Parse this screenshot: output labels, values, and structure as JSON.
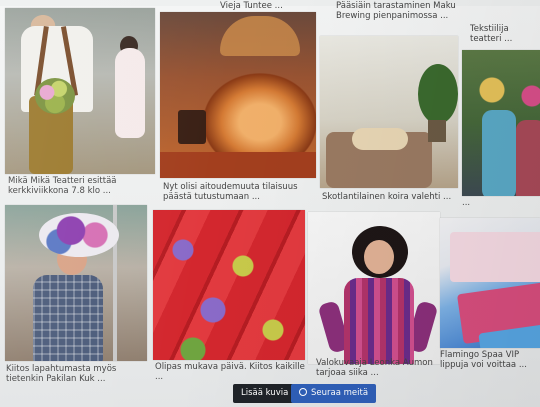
{
  "gallery": {
    "top_captions": [
      "Vieja Tuntee ...",
      "Pääsiäin tarastaminen Maku Brewing pienpanimossa ...",
      "Tekstiilija teatteri ..."
    ],
    "items": [
      {
        "caption": "Mikä Mikä Teatteri esittää kerkkiviikkona 7.8 klo ...",
        "image": "man-with-flowers-photo"
      },
      {
        "caption": "Nyt olisi aitoudemuuta tilaisuus päästä tutustumaan ...",
        "image": "copper-kettle-photo"
      },
      {
        "caption": "Skotlantilainen koira valehti ...",
        "image": "dog-on-couch-photo"
      },
      {
        "caption": "...",
        "image": "flower-festival-photo"
      },
      {
        "caption": "Kiitos lapahtumasta myös tietenkin Pakilan Kuk ...",
        "image": "woman-flower-hat-photo"
      },
      {
        "caption": "Olipas mukava päivä. Kiitos kaikille ...",
        "image": "red-flower-boxes-photo"
      },
      {
        "caption": "Valokuvaaja Leonka Aumon tarjoaa siika ...",
        "image": "woman-folk-costume-photo"
      },
      {
        "caption": "Flamingo Spaa VIP lippuja voi voittaa ...",
        "image": "spa-poster-photo"
      }
    ]
  },
  "actions": {
    "load_more_label": "Lisää kuvia",
    "follow_label": "Seuraa meitä",
    "follow_icon": "instagram-icon"
  }
}
